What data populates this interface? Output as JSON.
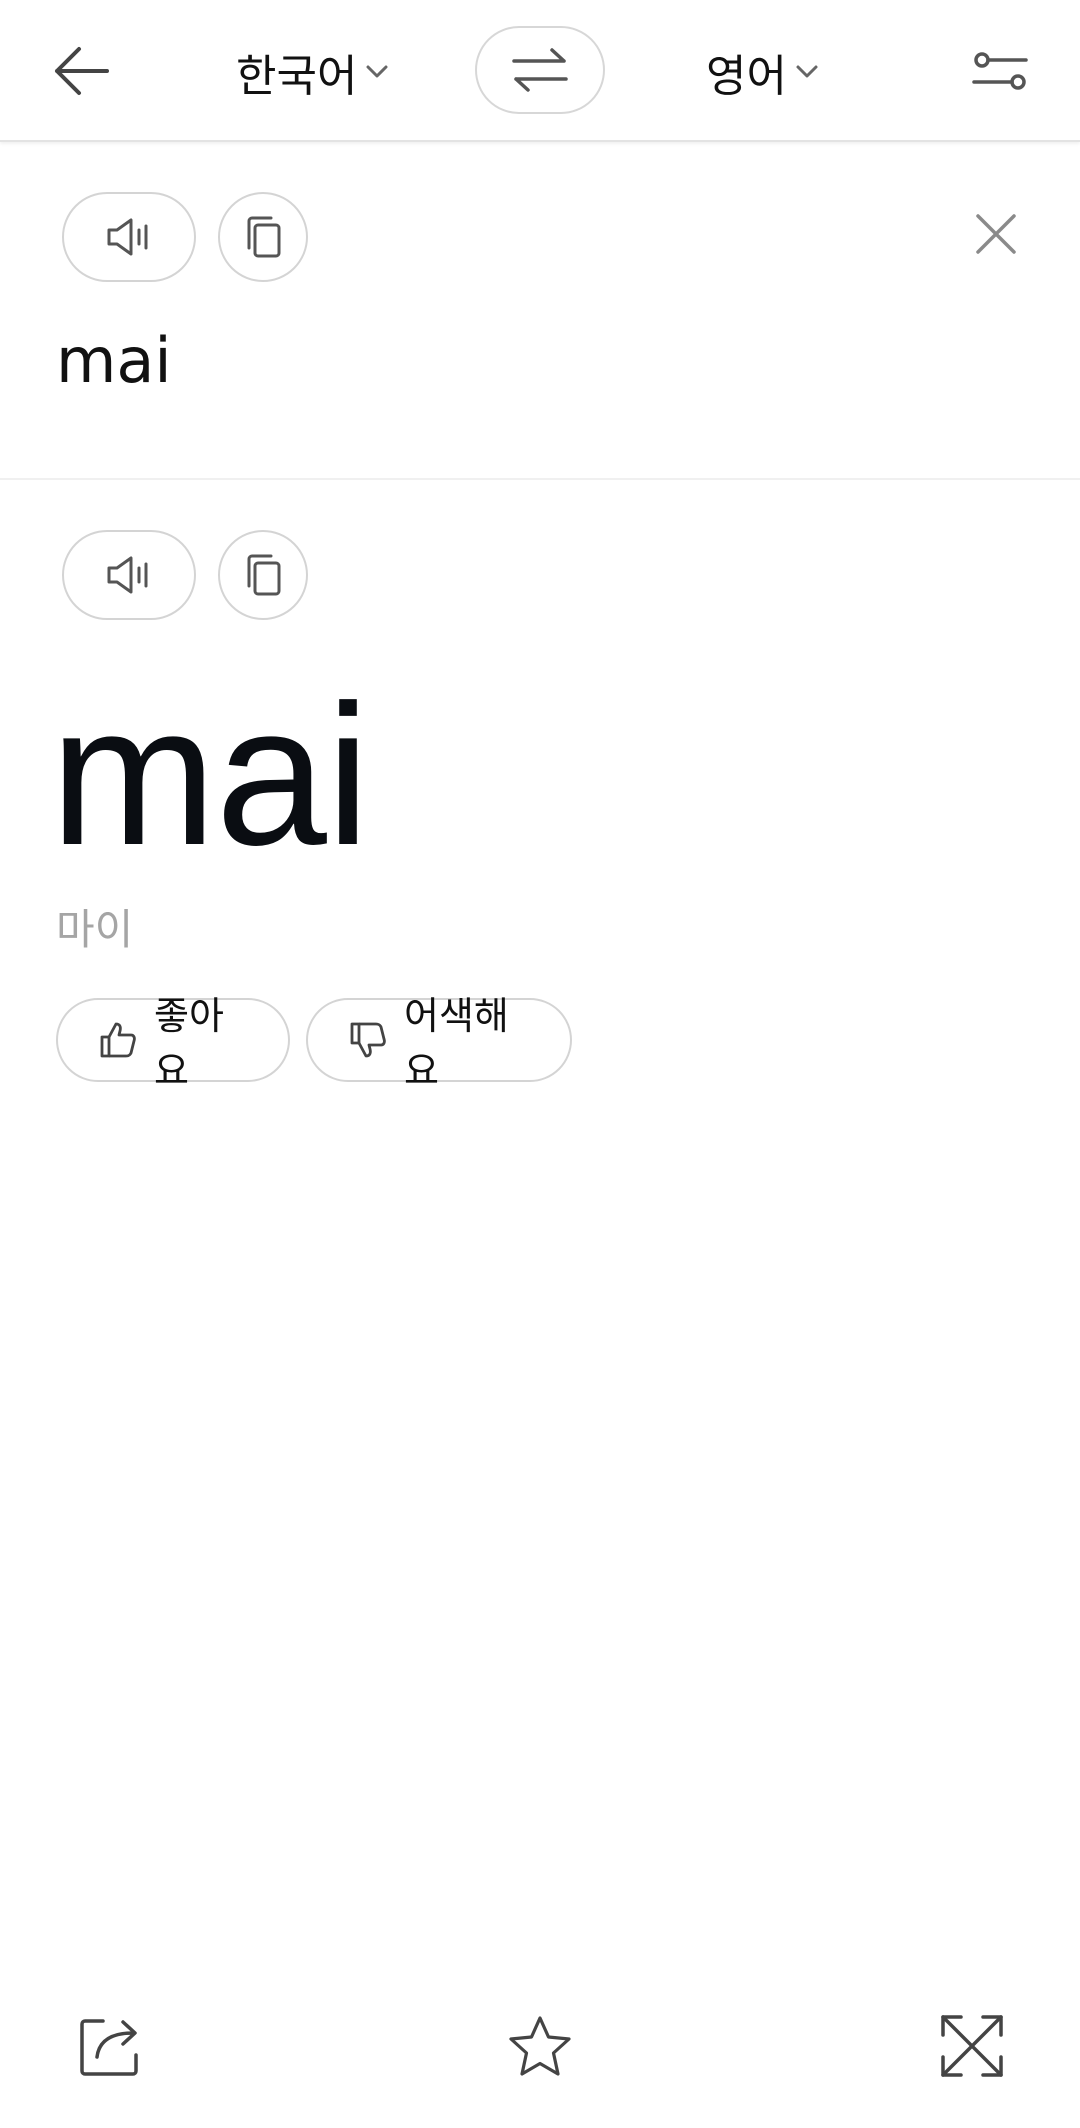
{
  "header": {
    "source_language": "한국어",
    "target_language": "영어",
    "icons": {
      "back": "arrow-left-icon",
      "swap": "swap-arrows-icon",
      "settings": "sliders-icon",
      "dropdown": "chevron-down-icon"
    }
  },
  "source": {
    "text": "mai",
    "icons": {
      "speak": "speaker-icon",
      "copy": "copy-icon",
      "clear": "close-icon"
    }
  },
  "result": {
    "text": "mai",
    "pronunciation": "마이",
    "like_label": "좋아요",
    "dislike_label": "어색해요",
    "icons": {
      "speak": "speaker-icon",
      "copy": "copy-icon",
      "like": "thumbs-up-icon",
      "dislike": "thumbs-down-icon"
    }
  },
  "bottom_bar": {
    "icons": {
      "share": "share-icon",
      "favorite": "star-icon",
      "expand": "expand-icon"
    }
  },
  "colors": {
    "text": "#111111",
    "muted": "#a5a5a5",
    "border": "#d4d4d4",
    "icon": "#555555"
  }
}
